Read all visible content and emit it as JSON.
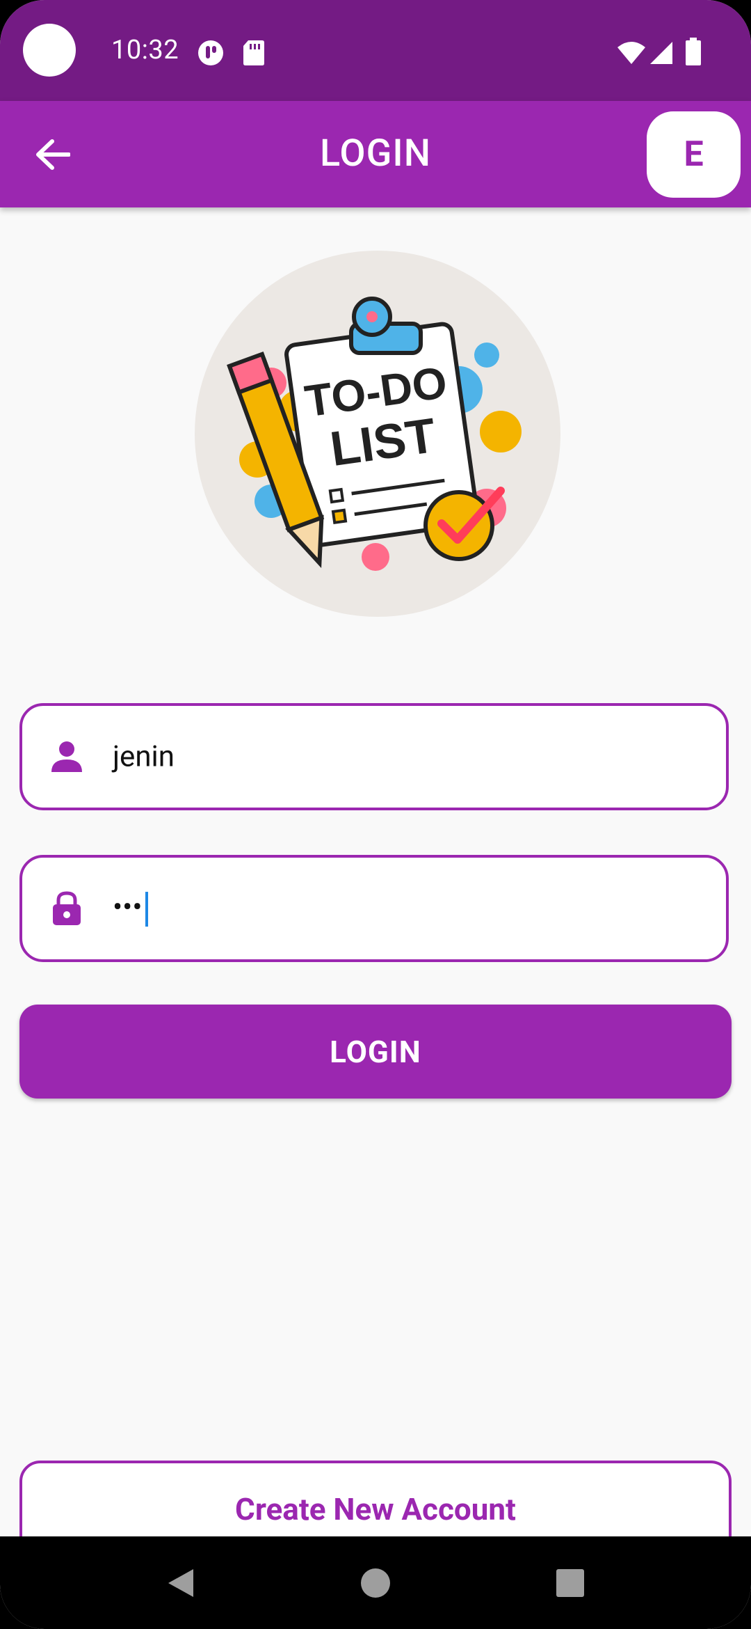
{
  "status_bar": {
    "time": "10:32",
    "icons": [
      "camera-cutout",
      "notification-icon",
      "sd-card-icon",
      "wifi-icon",
      "signal-icon",
      "battery-icon"
    ]
  },
  "app_bar": {
    "title": "LOGIN",
    "back_icon": "arrow-left-icon",
    "avatar_label": "E"
  },
  "logo": {
    "line1": "TO-DO",
    "line2": "LIST"
  },
  "form": {
    "username_value": "jenin",
    "password_value": "•••",
    "username_icon": "person-icon",
    "password_icon": "lock-icon",
    "login_label": "LOGIN",
    "create_account_label": "Create New Account"
  },
  "nav_bar": {
    "icons": [
      "back-triangle-icon",
      "home-circle-icon",
      "recents-square-icon"
    ]
  },
  "colors": {
    "primary": "#9b27b0",
    "status_bar": "#741b84",
    "background": "#f9f9f9",
    "caret": "#1e88e5"
  }
}
